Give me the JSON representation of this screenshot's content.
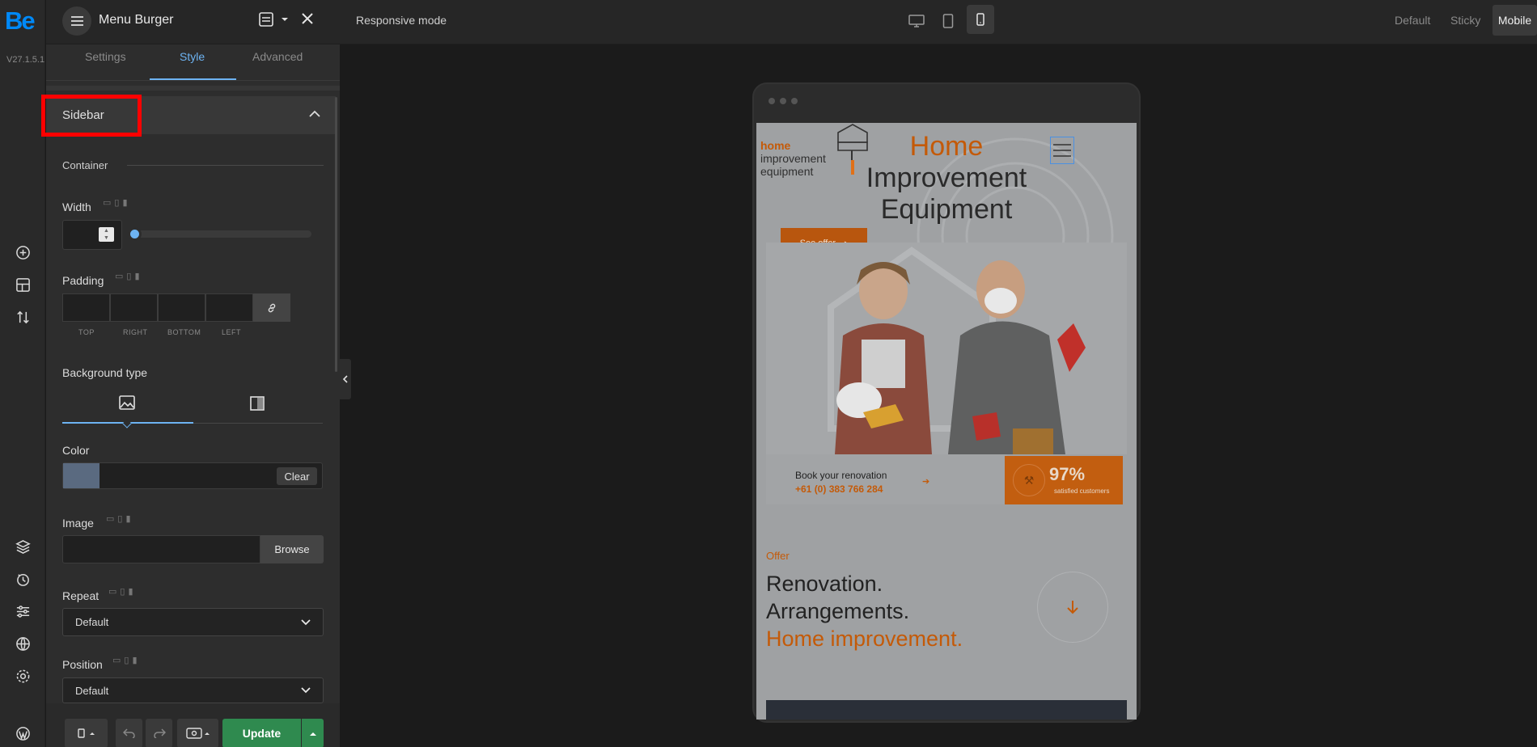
{
  "app": {
    "version": "V27.1.5.1",
    "logo": "Be"
  },
  "header": {
    "title": "Menu Burger",
    "responsive_label": "Responsive mode",
    "modes": [
      "Default",
      "Sticky",
      "Mobile"
    ]
  },
  "panel": {
    "tabs": [
      "Settings",
      "Style",
      "Advanced"
    ],
    "section": "Sidebar",
    "container_label": "Container",
    "width_label": "Width",
    "padding_label": "Padding",
    "padding_sides": [
      "TOP",
      "RIGHT",
      "BOTTOM",
      "LEFT"
    ],
    "bg_type_label": "Background type",
    "color_label": "Color",
    "clear_label": "Clear",
    "image_label": "Image",
    "browse_label": "Browse",
    "repeat_label": "Repeat",
    "repeat_value": "Default",
    "position_label": "Position",
    "position_value": "Default"
  },
  "bottom": {
    "update_label": "Update"
  },
  "preview": {
    "logo_line1": "home",
    "logo_line2": "improvement",
    "logo_line3": "equipment",
    "hero_line1": "Home",
    "hero_line2": "Improvement",
    "hero_line3": "Equipment",
    "cta": "See offer",
    "book_label": "Book your renovation",
    "phone": "+61 (0) 383 766 284",
    "stat_value": "97%",
    "stat_label": "satisfied customers",
    "offer_label": "Offer",
    "heading1": "Renovation.",
    "heading2": "Arrangements.",
    "heading3": "Home improvement."
  },
  "colors": {
    "accent": "#0089f7",
    "brand_orange": "#c45a08",
    "update_green": "#2f8a4f",
    "highlight_red": "#ff0000"
  }
}
